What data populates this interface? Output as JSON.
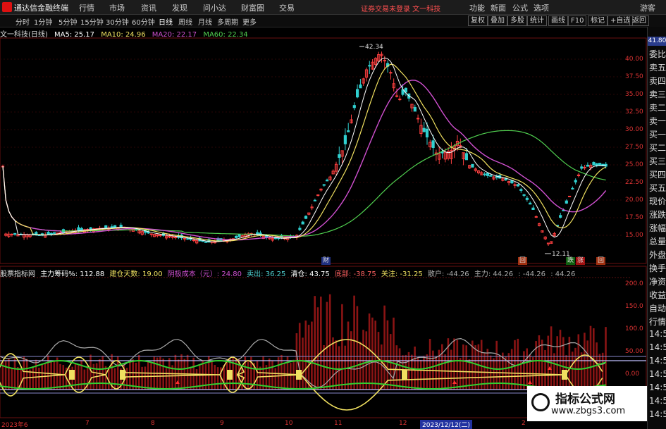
{
  "app": {
    "title": "通达信金融终端",
    "warning": "证券交易未登录  文一科技"
  },
  "menu": [
    "行情",
    "市场",
    "资讯",
    "发现",
    "问小达",
    "财富圈",
    "交易"
  ],
  "topright": [
    "功能",
    "新面",
    "公式",
    "选项",
    "游客"
  ],
  "timeframes": [
    "分时",
    "1分钟",
    "5分钟",
    "15分钟",
    "30分钟",
    "60分钟",
    "日线",
    "周线",
    "月线",
    "多周期",
    "更多"
  ],
  "active_timeframe": "日线",
  "toolbar": [
    "复权",
    "叠加",
    "多股",
    "统计",
    "画线",
    "F10",
    "标记",
    "+自选",
    "返回"
  ],
  "stock": {
    "name": "文一科技(日线)"
  },
  "ma": [
    {
      "label": "MA5: 25.17",
      "color": "#ffffff"
    },
    {
      "label": "MA10: 24.96",
      "color": "#f0e060"
    },
    {
      "label": "MA20: 22.17",
      "color": "#d050d0"
    },
    {
      "label": "MA60: 22.34",
      "color": "#50d050"
    }
  ],
  "price_ticks": [
    "40.00",
    "37.50",
    "35.00",
    "32.50",
    "30.00",
    "27.50",
    "25.00",
    "22.50",
    "20.00",
    "17.50",
    "15.00"
  ],
  "price_box": "41.80",
  "peak_label": "42.34",
  "low_label": "12.11",
  "chart_tags": [
    {
      "text": "财",
      "color": "#6080ff"
    },
    {
      "text": "回",
      "color": "#ff8040"
    },
    {
      "text": "跌",
      "color": "#30c030"
    },
    {
      "text": "涨",
      "color": "#ff4040"
    },
    {
      "text": "回",
      "color": "#ff8040"
    }
  ],
  "indicator": [
    {
      "text": "股票指标网",
      "color": "#dddddd"
    },
    {
      "text": "主力筹码%: 112.88",
      "color": "#ffffff"
    },
    {
      "text": "建仓天数: 19.00",
      "color": "#f0e060"
    },
    {
      "text": "阴极成本（元）: 24.80",
      "color": "#d050d0"
    },
    {
      "text": "卖出: 36.25",
      "color": "#50d0d0"
    },
    {
      "text": "清仓: 43.75",
      "color": "#ffffff"
    },
    {
      "text": "底部: -38.75",
      "color": "#ff6060"
    },
    {
      "text": "关注: -31.25",
      "color": "#f0e060"
    },
    {
      "text": "散户: -44.26",
      "color": "#aaaaaa"
    },
    {
      "text": "主力: 44.26",
      "color": "#aaaaaa"
    },
    {
      "text": ": -44.26",
      "color": "#aaaaaa"
    },
    {
      "text": ": 44.26",
      "color": "#aaaaaa"
    }
  ],
  "ind_ticks": [
    "200.0",
    "150.0",
    "100.0",
    "50.00",
    "0.00"
  ],
  "dates": [
    "2023年6",
    "7",
    "8",
    "9",
    "10",
    "11",
    "12",
    "2023/12/12(二)",
    "2"
  ],
  "sidebar": [
    "委比",
    "卖五",
    "卖四",
    "卖三",
    "卖二",
    "卖一",
    "买一",
    "买二",
    "买三",
    "买四",
    "买五",
    "现价",
    "涨跌",
    "涨幅",
    "总量",
    "外盘",
    "换手",
    "净资",
    "收益",
    "自动",
    "行情",
    "14:5",
    "14:5",
    "14:5",
    "14:5",
    "14:5",
    "14:5",
    "14:5"
  ]
}
